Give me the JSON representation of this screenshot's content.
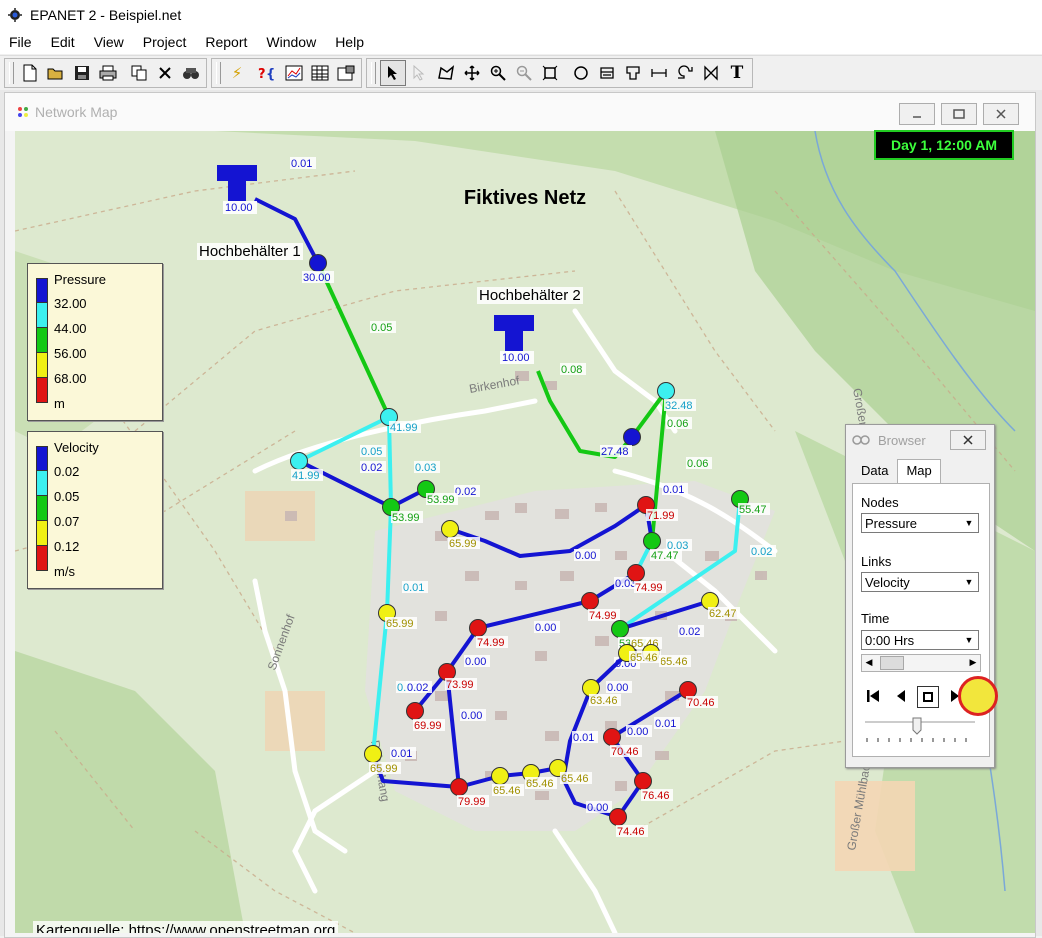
{
  "window": {
    "title": "EPANET 2 - Beispiel.net"
  },
  "menu": [
    "File",
    "Edit",
    "View",
    "Project",
    "Report",
    "Window",
    "Help"
  ],
  "toolbar": {
    "group1": [
      "new-file-icon",
      "open-folder-icon",
      "save-icon",
      "print-icon",
      "copy-icon",
      "delete-icon",
      "find-icon"
    ],
    "group2": [
      "run-icon",
      "query-icon",
      "graph-icon",
      "table-icon",
      "options-icon"
    ],
    "group3": [
      "select-object-icon",
      "select-vertex-icon",
      "select-region-icon",
      "pan-icon",
      "zoom-in-icon",
      "zoom-out-icon",
      "full-extent-icon",
      "add-junction-icon",
      "add-reservoir-icon",
      "add-tank-icon",
      "add-pipe-icon",
      "add-pump-icon",
      "add-valve-icon",
      "add-label-icon"
    ],
    "labels": {
      "t": "T",
      "lightning": "⚡"
    }
  },
  "network_window": {
    "title": "Network Map",
    "map_title": "Fiktives Netz",
    "clock": "Day 1, 12:00 AM",
    "credit": "Kartenquelle: https://www.openstreetmap.org",
    "tanks": [
      {
        "label": "Hochbehälter 1",
        "value": "10.00"
      },
      {
        "label": "Hochbehälter 2",
        "value": "10.00"
      }
    ]
  },
  "legend_pressure": {
    "title": "Pressure",
    "levels": [
      "32.00",
      "44.00",
      "56.00",
      "68.00"
    ],
    "unit": "m",
    "colors": [
      "#1414d2",
      "#3cf0f0",
      "#14c814",
      "#f0f014",
      "#e01414"
    ]
  },
  "legend_velocity": {
    "title": "Velocity",
    "levels": [
      "0.02",
      "0.05",
      "0.07",
      "0.12"
    ],
    "unit": "m/s",
    "colors": [
      "#1414d2",
      "#3cf0f0",
      "#14c814",
      "#f0f014",
      "#e01414"
    ]
  },
  "nodes": [
    {
      "v": "30.00",
      "c": "blue"
    },
    {
      "v": "41.99",
      "c": "cyan"
    },
    {
      "v": "41.99",
      "c": "cyan"
    },
    {
      "v": "53.99",
      "c": "green"
    },
    {
      "v": "53.99",
      "c": "green"
    },
    {
      "v": "27.48",
      "c": "blue"
    },
    {
      "v": "32.48",
      "c": "cyan"
    },
    {
      "v": "65.99",
      "c": "yellow"
    },
    {
      "v": "71.99",
      "c": "red"
    },
    {
      "v": "47.47",
      "c": "green"
    },
    {
      "v": "55.47",
      "c": "green"
    },
    {
      "v": "74.99",
      "c": "red"
    },
    {
      "v": "65.99",
      "c": "yellow"
    },
    {
      "v": "74.99",
      "c": "red"
    },
    {
      "v": "74.99",
      "c": "red"
    },
    {
      "v": "53.47",
      "c": "green"
    },
    {
      "v": "62.47",
      "c": "yellow"
    },
    {
      "v": "73.99",
      "c": "red"
    },
    {
      "v": "69.99",
      "c": "red"
    },
    {
      "v": "65.99",
      "c": "yellow"
    },
    {
      "v": "79.99",
      "c": "red"
    },
    {
      "v": "63.46",
      "c": "yellow"
    },
    {
      "v": "65.46",
      "c": "yellow"
    },
    {
      "v": "65.46",
      "c": "yellow"
    },
    {
      "v": "65.46",
      "c": "yellow"
    },
    {
      "v": "65.46",
      "c": "yellow"
    },
    {
      "v": "65.46",
      "c": "yellow"
    },
    {
      "v": "70.46",
      "c": "red"
    },
    {
      "v": "70.46",
      "c": "red"
    },
    {
      "v": "76.46",
      "c": "red"
    },
    {
      "v": "74.46",
      "c": "red"
    },
    {
      "v": "65.46",
      "c": "yellow"
    }
  ],
  "pipe_labels": [
    "0.01",
    "0.05",
    "0.08",
    "0.05",
    "0.02",
    "0.03",
    "0.02",
    "0.01",
    "0.06",
    "0.06",
    "0.01",
    "0.02",
    "0.03",
    "0.02",
    "0.00",
    "0.03",
    "0.02",
    "0.00",
    "0.00",
    "0.02",
    "0.00",
    "0.01",
    "0.01",
    "0.01",
    "0.00",
    "0.00",
    "0.00",
    "0.00"
  ],
  "browser": {
    "title": "Browser",
    "tabs": [
      "Data",
      "Map"
    ],
    "active_tab": "Map",
    "nodes_label": "Nodes",
    "nodes_value": "Pressure",
    "links_label": "Links",
    "links_value": "Velocity",
    "time_label": "Time",
    "time_value": "0:00 Hrs"
  }
}
